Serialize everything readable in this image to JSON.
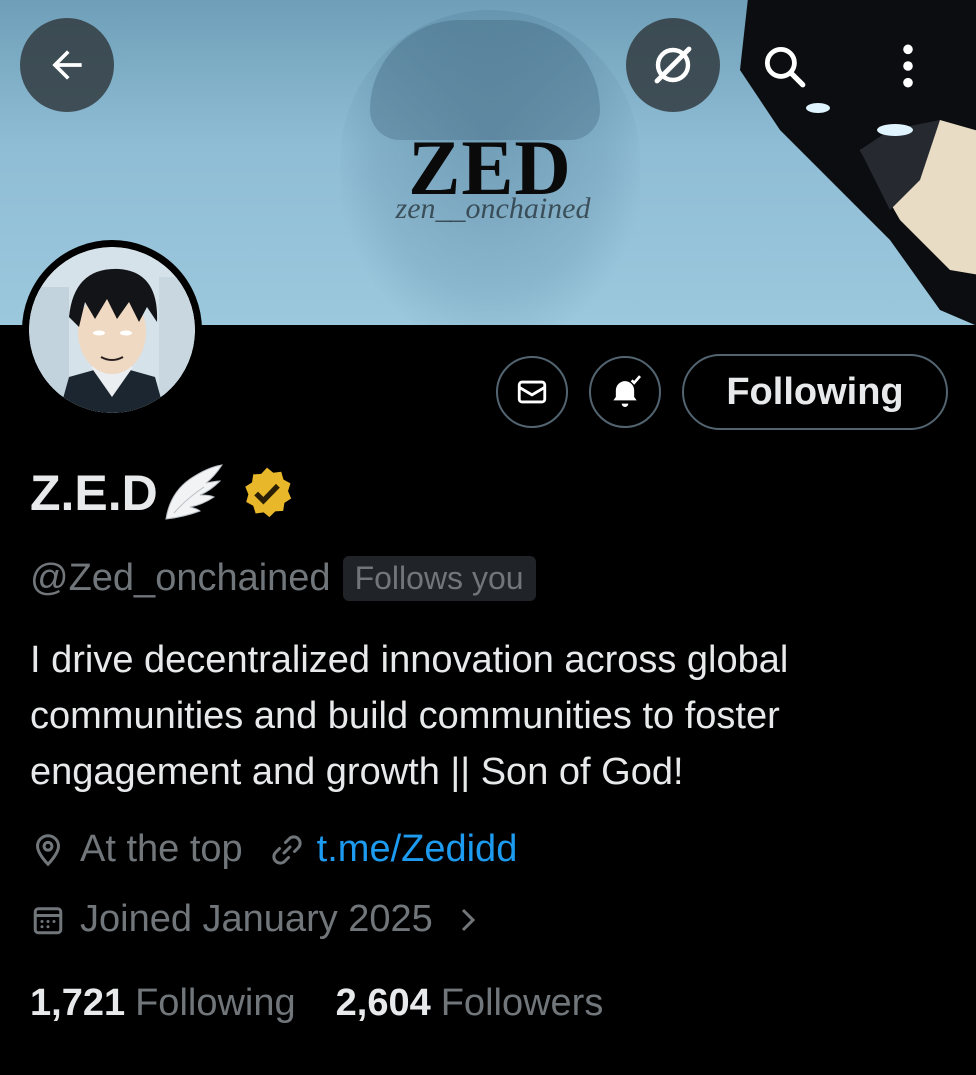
{
  "banner": {
    "title": "ZED",
    "subtitle": "zen__onchained"
  },
  "header_icons": {
    "back": "arrow-left-icon",
    "grok": "grok-icon",
    "search": "search-icon",
    "more": "more-vertical-icon"
  },
  "actions": {
    "message_icon": "envelope-icon",
    "notify_icon": "bell-check-icon",
    "follow_label": "Following"
  },
  "profile": {
    "display_name": "Z.E.D",
    "name_emoji": "wing-icon",
    "verified_badge": "verified-gold-icon",
    "handle": "@Zed_onchained",
    "follows_you": "Follows you",
    "bio": "I drive decentralized innovation across global communities and build communities to foster engagement and growth || Son of God!",
    "location": "At the top",
    "website": "t.me/Zedidd",
    "joined": "Joined January 2025",
    "following_count": "1,721",
    "following_label": "Following",
    "followers_count": "2,604",
    "followers_label": "Followers"
  },
  "colors": {
    "background": "#000000",
    "text_primary": "#e7e9ea",
    "text_secondary": "#71767b",
    "link": "#1d9bf0",
    "border": "#536471",
    "verified_gold": "#e8b82a"
  }
}
